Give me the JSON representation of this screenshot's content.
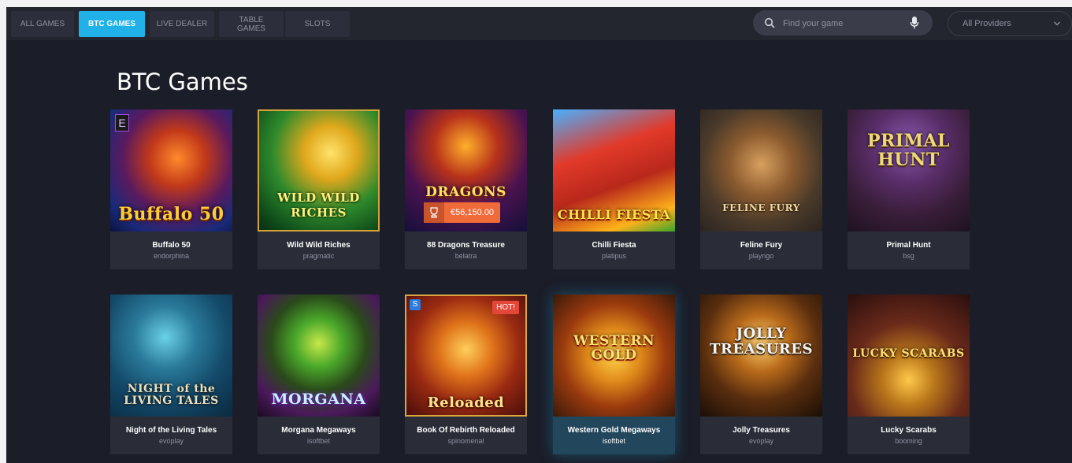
{
  "nav": {
    "tabs": [
      {
        "label": "ALL GAMES",
        "active": false
      },
      {
        "label": "BTC GAMES",
        "active": true
      },
      {
        "label": "LIVE DEALER",
        "active": false
      },
      {
        "label": "TABLE GAMES",
        "active": false
      },
      {
        "label": "SLOTS",
        "active": false
      }
    ],
    "search_placeholder": "Find your game",
    "providers_select": "All Providers"
  },
  "section_title": "BTC Games",
  "colors": {
    "accent": "#1fb1e8",
    "card_bg": "#2a2d38",
    "page_bg": "#1b1d28",
    "hot": "#e2473a",
    "jackpot": "#f06b3a"
  },
  "games": [
    {
      "name": "Buffalo 50",
      "provider": "endorphina",
      "art_title": "Buffalo 50"
    },
    {
      "name": "Wild Wild Riches",
      "provider": "pragmatic",
      "art_title": "WILD WILD RICHES"
    },
    {
      "name": "88 Dragons Treasure",
      "provider": "belatra",
      "art_title": "DRAGONS",
      "jackpot": "€56,150.00"
    },
    {
      "name": "Chilli Fiesta",
      "provider": "platipus",
      "art_title": "CHILLI FIESTA"
    },
    {
      "name": "Feline Fury",
      "provider": "playngo",
      "art_title": "FELINE FURY"
    },
    {
      "name": "Primal Hunt",
      "provider": "bsg",
      "art_title": "PRIMAL HUNT"
    },
    {
      "name": "Night of the Living Tales",
      "provider": "evoplay",
      "art_title": "NIGHT of the LIVING TALES"
    },
    {
      "name": "Morgana Megaways",
      "provider": "isoftbet",
      "art_title": "MORGANA"
    },
    {
      "name": "Book Of Rebirth Reloaded",
      "provider": "spinomenal",
      "art_title": "Reloaded",
      "badge": "HOT!"
    },
    {
      "name": "Western Gold Megaways",
      "provider": "isoftbet",
      "art_title": "WESTERN GOLD",
      "highlight": true
    },
    {
      "name": "Jolly Treasures",
      "provider": "evoplay",
      "art_title": "JOLLY TREASURES"
    },
    {
      "name": "Lucky Scarabs",
      "provider": "booming",
      "art_title": "LUCKY SCARABS"
    }
  ]
}
